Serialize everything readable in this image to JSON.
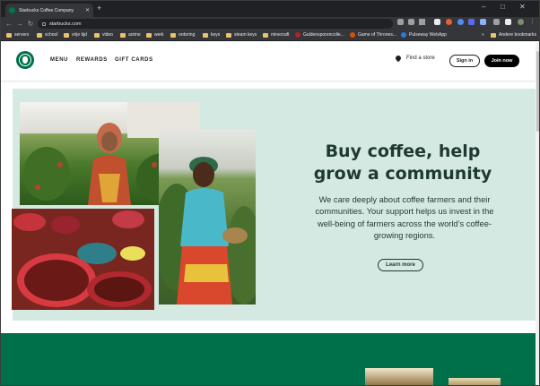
{
  "browser": {
    "tab_title": "Starbucks Coffee Company",
    "url": "starbucks.com",
    "new_tab_symbol": "+",
    "close_symbol": "✕",
    "window_controls": [
      "–",
      "□",
      "✕"
    ]
  },
  "bookmarks": [
    {
      "label": "servers",
      "icon": "folder-icon"
    },
    {
      "label": "school",
      "icon": "folder-icon"
    },
    {
      "label": "vrije tijd",
      "icon": "folder-icon"
    },
    {
      "label": "video",
      "icon": "folder-icon"
    },
    {
      "label": "anime",
      "icon": "folder-icon"
    },
    {
      "label": "werk",
      "icon": "folder-icon"
    },
    {
      "label": "ordering",
      "icon": "folder-icon"
    },
    {
      "label": "keys",
      "icon": "folder-icon"
    },
    {
      "label": "steam keys",
      "icon": "folder-icon"
    },
    {
      "label": "minecraft",
      "icon": "folder-icon"
    },
    {
      "label": "Guldensporencolle...",
      "icon": "site-icon",
      "color": "#b22222"
    },
    {
      "label": "Game of Thrones...",
      "icon": "site-icon",
      "color": "#d35400"
    },
    {
      "label": "Pulseway WebApp",
      "icon": "site-icon",
      "color": "#2a7ae2"
    },
    {
      "label": "»",
      "icon": ""
    },
    {
      "label": "Andere bookmarks",
      "icon": "folder-icon"
    }
  ],
  "header": {
    "nav": [
      "MENU",
      "REWARDS",
      "GIFT CARDS"
    ],
    "find_store": "Find a store",
    "sign_in": "Sign in",
    "join_now": "Join now"
  },
  "hero": {
    "title_line1": "Buy coffee, help",
    "title_line2": "grow a community",
    "body": "We care deeply about coffee farmers and their communities. Your support helps us invest in the well-being of farmers across the world’s coffee-growing regions.",
    "cta": "Learn more"
  },
  "colors": {
    "brand_green": "#00704a",
    "hero_bg": "#d4e9e2",
    "hero_text": "#1e3932"
  }
}
